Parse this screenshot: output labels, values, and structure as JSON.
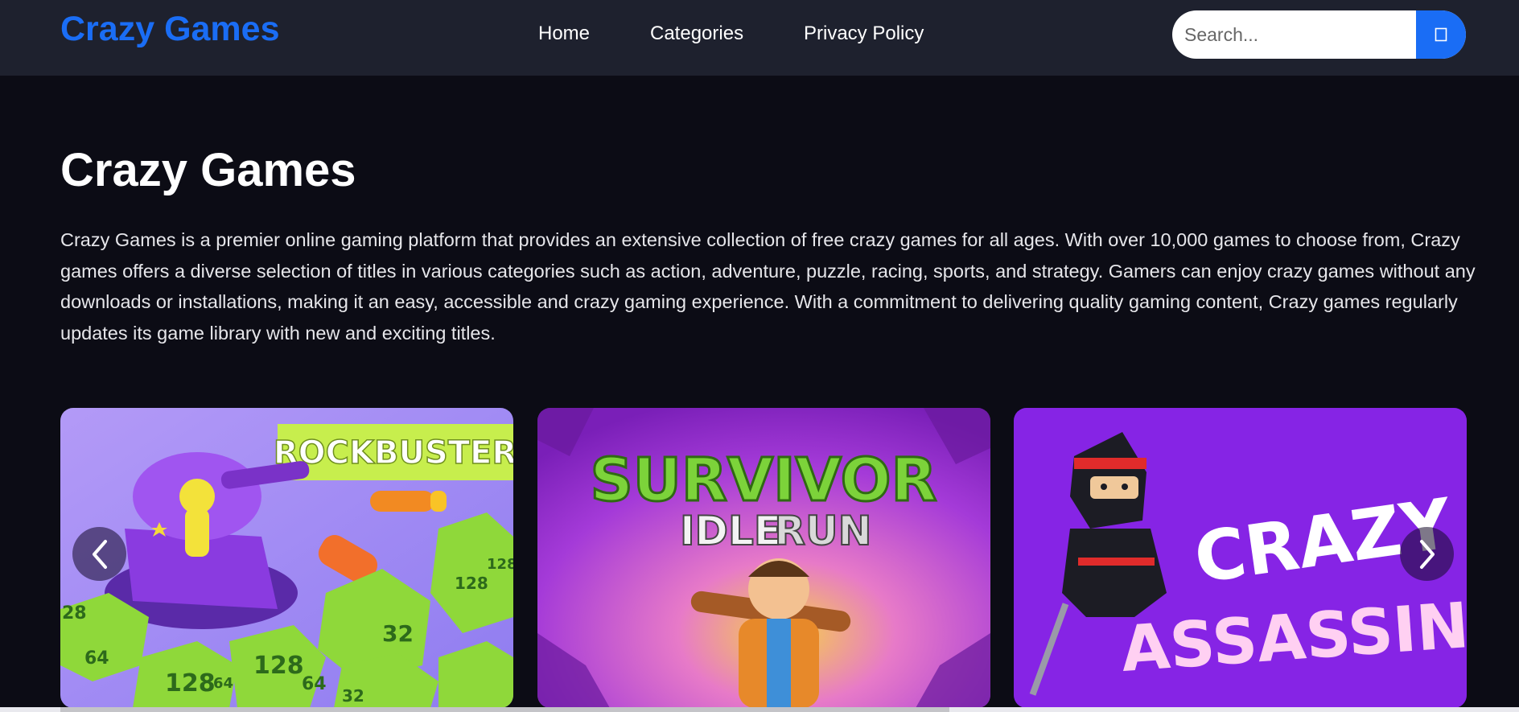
{
  "header": {
    "brand": "Crazy Games",
    "nav": [
      "Home",
      "Categories",
      "Privacy Policy"
    ],
    "search": {
      "placeholder": "Search...",
      "button_icon": "search-icon"
    }
  },
  "hero": {
    "title": "Crazy Games",
    "description": "Crazy Games is a premier online gaming platform that provides an extensive collection of free crazy games for all ages. With over 10,000 games to choose from, Crazy games offers a diverse selection of titles in various categories such as action, adventure, puzzle, racing, sports, and strategy. Gamers can enjoy crazy games without any downloads or installations, making it an easy, accessible and crazy gaming experience. With a commitment to delivering quality gaming content, Crazy games regularly updates its game library with new and exciting titles."
  },
  "carousel": {
    "prev_icon": "chevron-left-icon",
    "next_icon": "chevron-right-icon",
    "games": [
      {
        "title": "ROCKBUSTER",
        "numbers": [
          "128",
          "64",
          "32",
          "28",
          "64",
          "128",
          "32",
          "64",
          "128",
          "128"
        ]
      },
      {
        "title_line1": "SURVIVOR",
        "title_line2_a": "IDLE",
        "title_line2_b": "RUN"
      },
      {
        "title_line1": "CRAZY",
        "title_line2": "ASSASSIN"
      }
    ]
  },
  "colors": {
    "accent": "#1a6df5",
    "header_bg": "#1e212e",
    "page_bg": "#0c0c15"
  }
}
